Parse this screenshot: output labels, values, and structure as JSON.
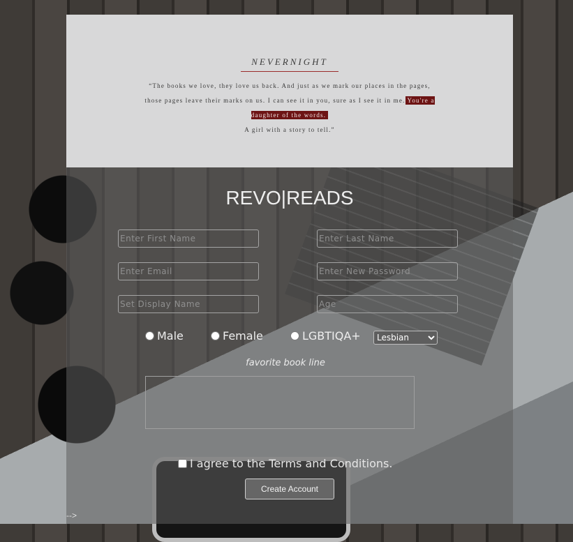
{
  "quote_banner": {
    "title": "NEVERNIGHT",
    "quote": "“The books we love, they love us back. And just as we mark our places in the pages, those pages leave their marks on us. I can see it in you, sure as I see it in me.",
    "highlight": "You're a daughter of the words.",
    "ending": "A girl with a story to tell.”",
    "highlight_color": "#6d1414"
  },
  "brand": "REVO|READS",
  "form": {
    "first_name_placeholder": "Enter First Name",
    "last_name_placeholder": "Enter Last Name",
    "email_placeholder": "Enter Email",
    "password_placeholder": "Enter New Password",
    "display_name_placeholder": "Set Display Name",
    "age_placeholder": "Age",
    "gender_options": [
      "Male",
      "Female",
      "LGBTIQA+"
    ],
    "orientation_selected": "Lesbian",
    "favorite_label": "favorite book line",
    "terms_label": "I agree to the Terms and Conditions.",
    "submit_label": "Create Account"
  },
  "stray_text": "-->"
}
